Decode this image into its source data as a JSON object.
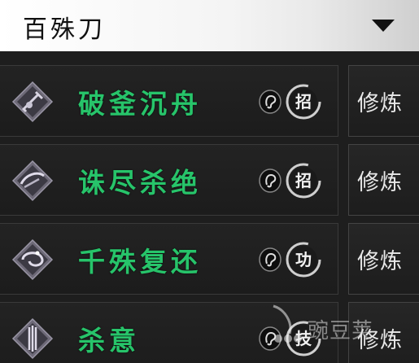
{
  "header": {
    "title": "百殊刀",
    "dropdown_icon": "triangle-down-icon"
  },
  "skills": [
    {
      "name": "破釜沉舟",
      "tag": "招",
      "action": "修炼",
      "icon": "sword-skill-icon"
    },
    {
      "name": "诛尽杀绝",
      "tag": "招",
      "action": "修炼",
      "icon": "slash-skill-icon"
    },
    {
      "name": "千殊复还",
      "tag": "功",
      "action": "修炼",
      "icon": "swirl-skill-icon"
    },
    {
      "name": "杀意",
      "tag": "技",
      "action": "修炼",
      "icon": "blades-skill-icon"
    }
  ],
  "watermark": {
    "text": "豌豆荚"
  },
  "colors": {
    "skill_name": "#27c46a",
    "header_bg": "#f4f4f4",
    "panel_bg": "#1e1e1e"
  }
}
